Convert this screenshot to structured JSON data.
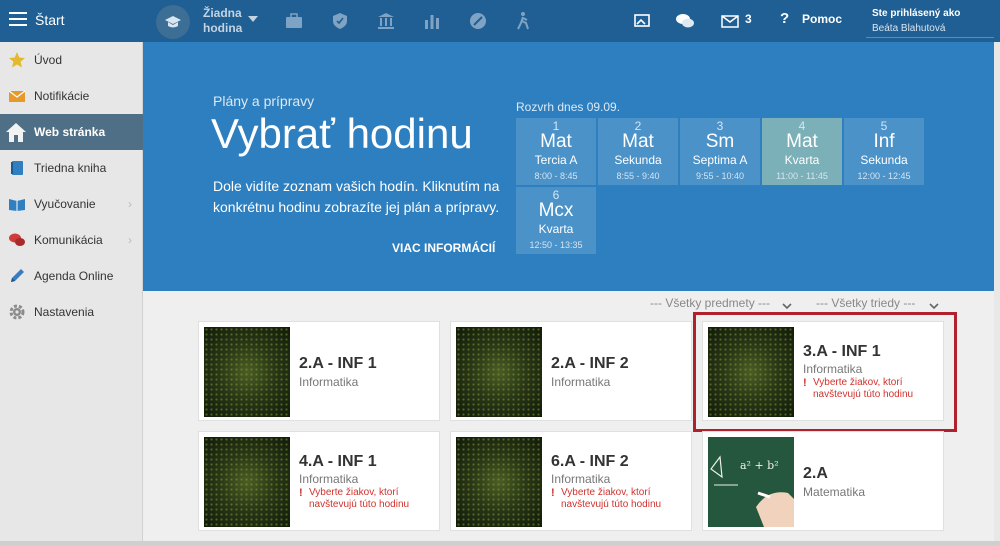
{
  "topbar": {
    "start_label": "Štart",
    "lesson_line1": "Žiadna",
    "lesson_line2": "hodina",
    "message_count": "3",
    "help_label": "Pomoc",
    "user_status": "Ste prihlásený ako",
    "user_name": "Beáta Blahutová",
    "icons": [
      "menu-icon",
      "graduation-cap-icon",
      "briefcase-icon",
      "shield-icon",
      "bank-icon",
      "bar-chart-icon",
      "satellite-icon",
      "hiking-icon",
      "cast-icon",
      "chat-icon",
      "mail-icon",
      "help-icon"
    ]
  },
  "sidebar": {
    "items": [
      {
        "label": "Úvod",
        "icon": "star-icon",
        "active": false
      },
      {
        "label": "Notifikácie",
        "icon": "envelope-icon",
        "active": false
      },
      {
        "label": "Web stránka",
        "icon": "house-icon",
        "active": true
      },
      {
        "label": "Triedna kniha",
        "icon": "book-icon",
        "active": false
      },
      {
        "label": "Vyučovanie",
        "icon": "open-book-icon",
        "active": false,
        "arrow": "›"
      },
      {
        "label": "Komunikácia",
        "icon": "chat-bubbles-icon",
        "active": false,
        "arrow": "›"
      },
      {
        "label": "Agenda Online",
        "icon": "pencil-icon",
        "active": false
      },
      {
        "label": "Nastavenia",
        "icon": "gear-icon",
        "active": false
      }
    ]
  },
  "hero": {
    "subtitle": "Plány a prípravy",
    "title": "Vybrať hodinu",
    "description": "Dole vidíte zoznam vašich hodín. Kliknutím na konkrétnu hodinu zobrazíte jej plán a prípravy.",
    "more_link": "VIAC INFORMÁCIÍ",
    "schedule_title": "Rozvrh dnes 09.09.",
    "schedule": [
      {
        "num": "1",
        "subject": "Mat",
        "class": "Tercia A",
        "time": "8:00 - 8:45",
        "current": false
      },
      {
        "num": "2",
        "subject": "Mat",
        "class": "Sekunda",
        "time": "8:55 - 9:40",
        "current": false
      },
      {
        "num": "3",
        "subject": "Sm",
        "class": "Septima A",
        "time": "9:55 - 10:40",
        "current": false
      },
      {
        "num": "4",
        "subject": "Mat",
        "class": "Kvarta",
        "time": "11:00 - 11:45",
        "current": true
      },
      {
        "num": "5",
        "subject": "Inf",
        "class": "Sekunda",
        "time": "12:00 - 12:45",
        "current": false
      },
      {
        "num": "6",
        "subject": "Mcx",
        "class": "Kvarta",
        "time": "12:50 - 13:35",
        "current": false
      }
    ]
  },
  "filters": {
    "subjects": "--- Všetky predmety ---",
    "classes": "--- Všetky triedy ---"
  },
  "cards": [
    {
      "title": "2.A - INF 1",
      "subject": "Informatika",
      "warning": "",
      "thumb": "code"
    },
    {
      "title": "2.A - INF 2",
      "subject": "Informatika",
      "warning": "",
      "thumb": "code"
    },
    {
      "title": "3.A - INF 1",
      "subject": "Informatika",
      "warning": "Vyberte žiakov, ktorí navštevujú túto hodinu",
      "thumb": "code",
      "highlighted": true
    },
    {
      "title": "4.A - INF 1",
      "subject": "Informatika",
      "warning": "Vyberte žiakov, ktorí navštevujú túto hodinu",
      "thumb": "code"
    },
    {
      "title": "6.A - INF 2",
      "subject": "Informatika",
      "warning": "Vyberte žiakov, ktorí navštevujú túto hodinu",
      "thumb": "code"
    },
    {
      "title": "2.A",
      "subject": "Matematika",
      "warning": "",
      "thumb": "chalkboard"
    }
  ],
  "warning_bang": "!",
  "chalkboard_text": "a² + b²"
}
